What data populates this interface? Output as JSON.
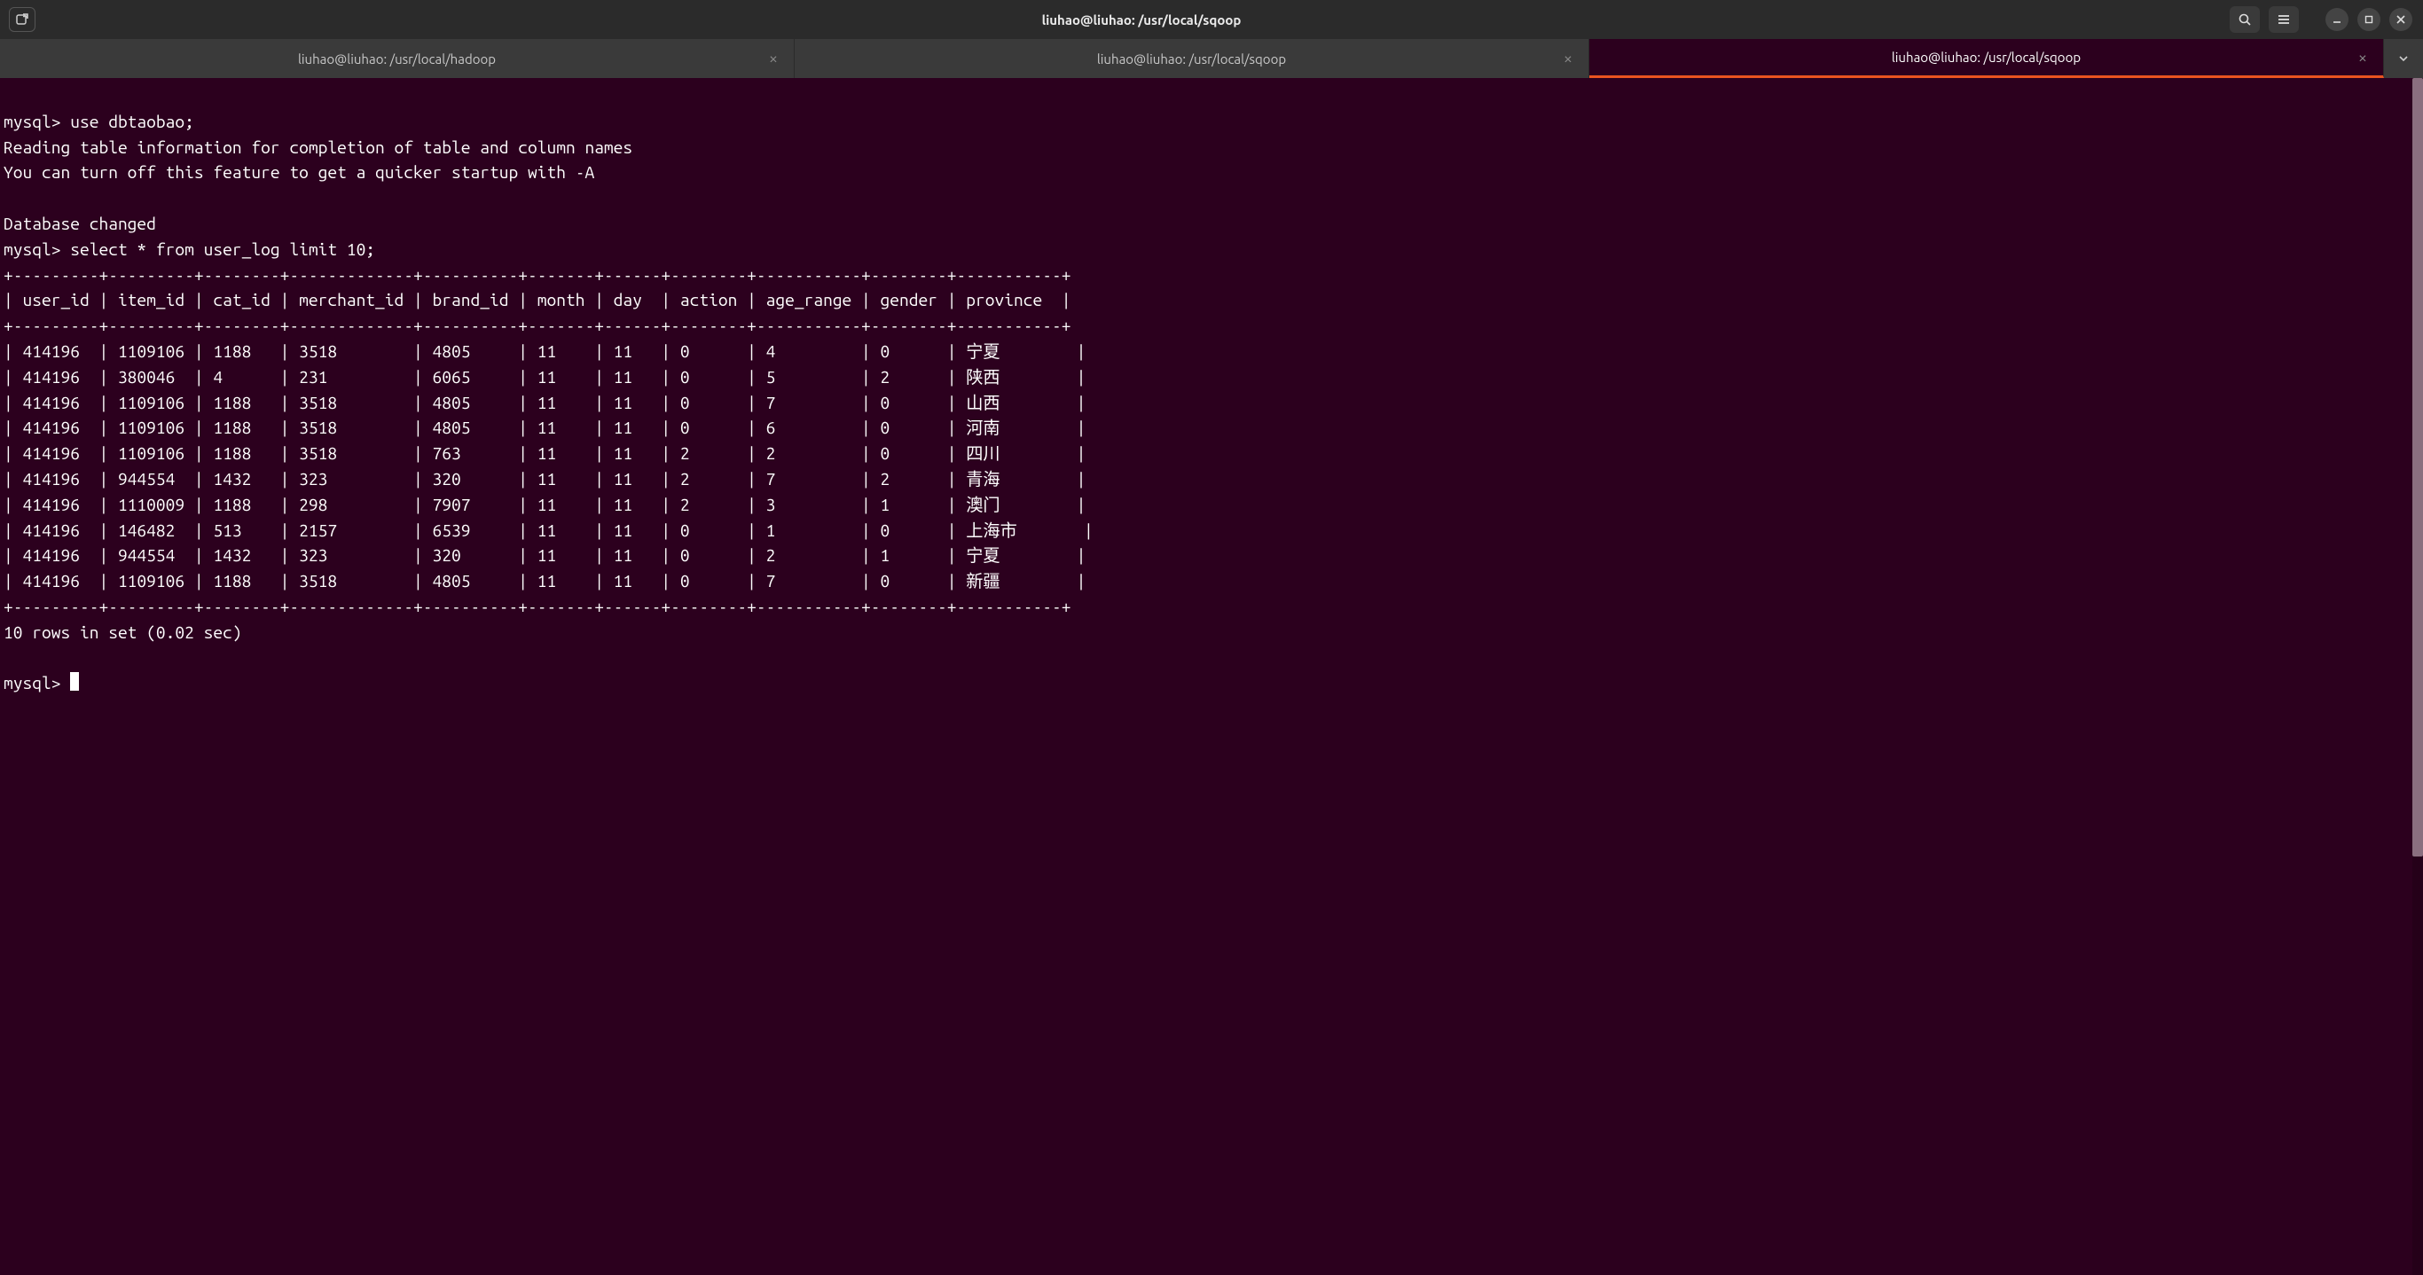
{
  "window": {
    "title": "liuhao@liuhao: /usr/local/sqoop"
  },
  "tabs": [
    {
      "label": "liuhao@liuhao: /usr/local/hadoop",
      "active": false
    },
    {
      "label": "liuhao@liuhao: /usr/local/sqoop",
      "active": false
    },
    {
      "label": "liuhao@liuhao: /usr/local/sqoop",
      "active": true
    }
  ],
  "terminal": {
    "prompt": "mysql>",
    "commands": {
      "use_db": "use dbtaobao;",
      "select": "select * from user_log limit 10;"
    },
    "messages": {
      "reading": "Reading table information for completion of table and column names",
      "turnoff": "You can turn off this feature to get a quicker startup with -A",
      "dbchanged": "Database changed",
      "rowcount": "10 rows in set (0.02 sec)"
    },
    "table": {
      "columns": [
        "user_id",
        "item_id",
        "cat_id",
        "merchant_id",
        "brand_id",
        "month",
        "day",
        "action",
        "age_range",
        "gender",
        "province"
      ],
      "rows": [
        {
          "user_id": "414196",
          "item_id": "1109106",
          "cat_id": "1188",
          "merchant_id": "3518",
          "brand_id": "4805",
          "month": "11",
          "day": "11",
          "action": "0",
          "age_range": "4",
          "gender": "0",
          "province": "宁夏"
        },
        {
          "user_id": "414196",
          "item_id": "380046",
          "cat_id": "4",
          "merchant_id": "231",
          "brand_id": "6065",
          "month": "11",
          "day": "11",
          "action": "0",
          "age_range": "5",
          "gender": "2",
          "province": "陕西"
        },
        {
          "user_id": "414196",
          "item_id": "1109106",
          "cat_id": "1188",
          "merchant_id": "3518",
          "brand_id": "4805",
          "month": "11",
          "day": "11",
          "action": "0",
          "age_range": "7",
          "gender": "0",
          "province": "山西"
        },
        {
          "user_id": "414196",
          "item_id": "1109106",
          "cat_id": "1188",
          "merchant_id": "3518",
          "brand_id": "4805",
          "month": "11",
          "day": "11",
          "action": "0",
          "age_range": "6",
          "gender": "0",
          "province": "河南"
        },
        {
          "user_id": "414196",
          "item_id": "1109106",
          "cat_id": "1188",
          "merchant_id": "3518",
          "brand_id": "763",
          "month": "11",
          "day": "11",
          "action": "2",
          "age_range": "2",
          "gender": "0",
          "province": "四川"
        },
        {
          "user_id": "414196",
          "item_id": "944554",
          "cat_id": "1432",
          "merchant_id": "323",
          "brand_id": "320",
          "month": "11",
          "day": "11",
          "action": "2",
          "age_range": "7",
          "gender": "2",
          "province": "青海"
        },
        {
          "user_id": "414196",
          "item_id": "1110009",
          "cat_id": "1188",
          "merchant_id": "298",
          "brand_id": "7907",
          "month": "11",
          "day": "11",
          "action": "2",
          "age_range": "3",
          "gender": "1",
          "province": "澳门"
        },
        {
          "user_id": "414196",
          "item_id": "146482",
          "cat_id": "513",
          "merchant_id": "2157",
          "brand_id": "6539",
          "month": "11",
          "day": "11",
          "action": "0",
          "age_range": "1",
          "gender": "0",
          "province": "上海市"
        },
        {
          "user_id": "414196",
          "item_id": "944554",
          "cat_id": "1432",
          "merchant_id": "323",
          "brand_id": "320",
          "month": "11",
          "day": "11",
          "action": "0",
          "age_range": "2",
          "gender": "1",
          "province": "宁夏"
        },
        {
          "user_id": "414196",
          "item_id": "1109106",
          "cat_id": "1188",
          "merchant_id": "3518",
          "brand_id": "4805",
          "month": "11",
          "day": "11",
          "action": "0",
          "age_range": "7",
          "gender": "0",
          "province": "新疆"
        }
      ],
      "col_widths": {
        "user_id": 9,
        "item_id": 9,
        "cat_id": 8,
        "merchant_id": 13,
        "brand_id": 10,
        "month": 7,
        "day": 6,
        "action": 8,
        "age_range": 11,
        "gender": 8,
        "province": 11
      }
    }
  },
  "colors": {
    "background": "#2c001e",
    "titlebar": "#2b2b2b",
    "tabbar": "#3a3a3a",
    "accent": "#e95420",
    "text": "#ffffff"
  }
}
